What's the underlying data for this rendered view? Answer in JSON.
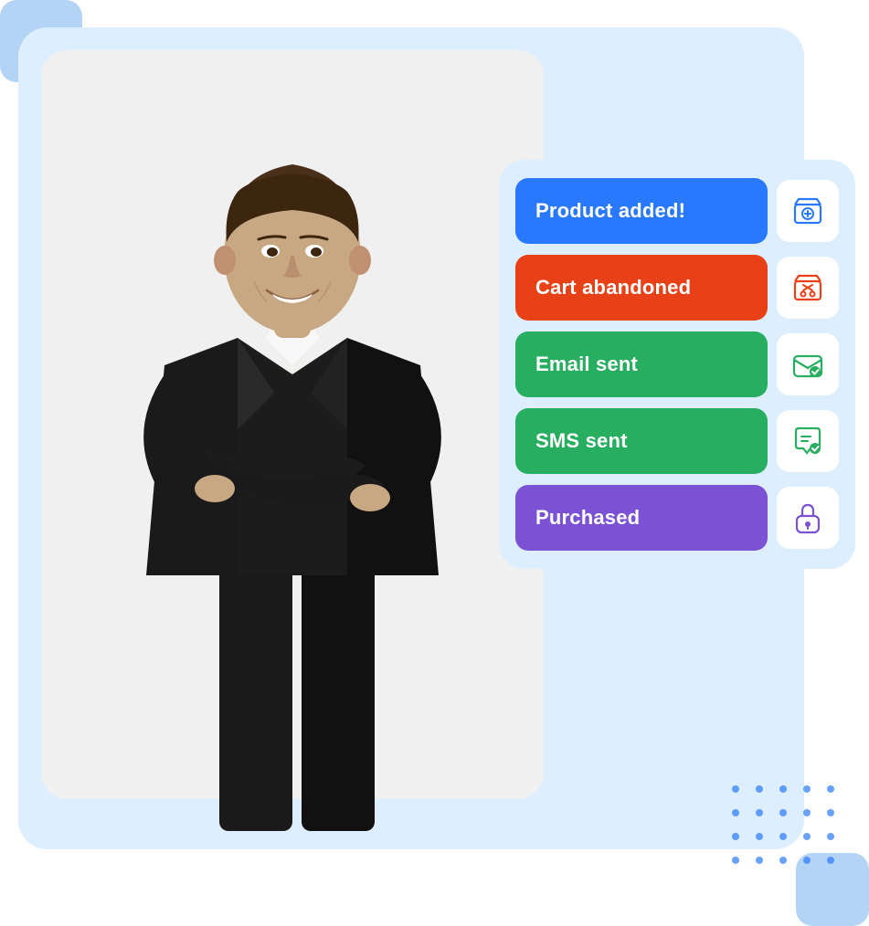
{
  "background": {
    "large_rect_color": "#ddeeff",
    "person_bg_color": "#f0f0f0"
  },
  "events": [
    {
      "id": "product-added",
      "label": "Product added!",
      "color_class": "blue",
      "color": "#2979ff",
      "icon": "store-plus"
    },
    {
      "id": "cart-abandoned",
      "label": "Cart abandoned",
      "color_class": "red",
      "color": "#e84118",
      "icon": "store-cart"
    },
    {
      "id": "email-sent",
      "label": "Email sent",
      "color_class": "green",
      "color": "#27ae60",
      "icon": "email-check"
    },
    {
      "id": "sms-sent",
      "label": "SMS sent",
      "color_class": "green",
      "color": "#27ae60",
      "icon": "sms-check"
    },
    {
      "id": "purchased",
      "label": "Purchased",
      "color_class": "purple",
      "color": "#7b52d3",
      "icon": "lock-bag"
    }
  ],
  "dots": {
    "rows": 4,
    "cols": 5,
    "color": "#2979ff"
  }
}
